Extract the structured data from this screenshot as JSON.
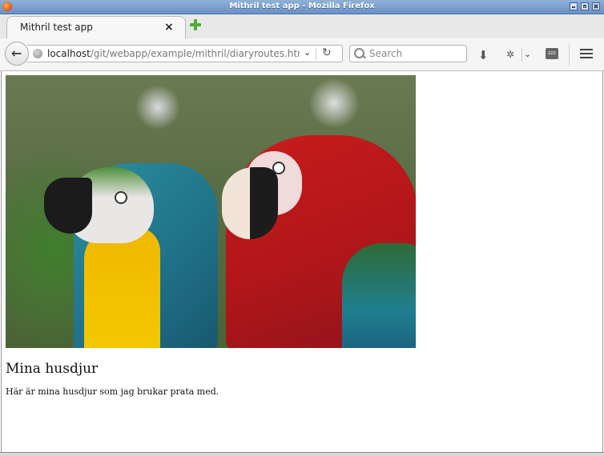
{
  "window": {
    "title": "Mithril test app - Mozilla Firefox"
  },
  "tabs": [
    {
      "label": "Mithril test app",
      "close_glyph": "×"
    }
  ],
  "navbar": {
    "url_host": "localhost",
    "url_path": "/git/webapp/example/mithril/diaryroutes.html#",
    "search_placeholder": "Search",
    "zzz_label": "zzz"
  },
  "page": {
    "heading": "Mina husdjur",
    "paragraph": "Här är mina husdjur som jag brukar prata med."
  },
  "icons": {
    "back": "back-arrow-icon",
    "globe": "globe-icon",
    "reload": "reload-icon",
    "search": "search-icon",
    "download": "download-icon",
    "menu": "hamburger-menu-icon"
  }
}
